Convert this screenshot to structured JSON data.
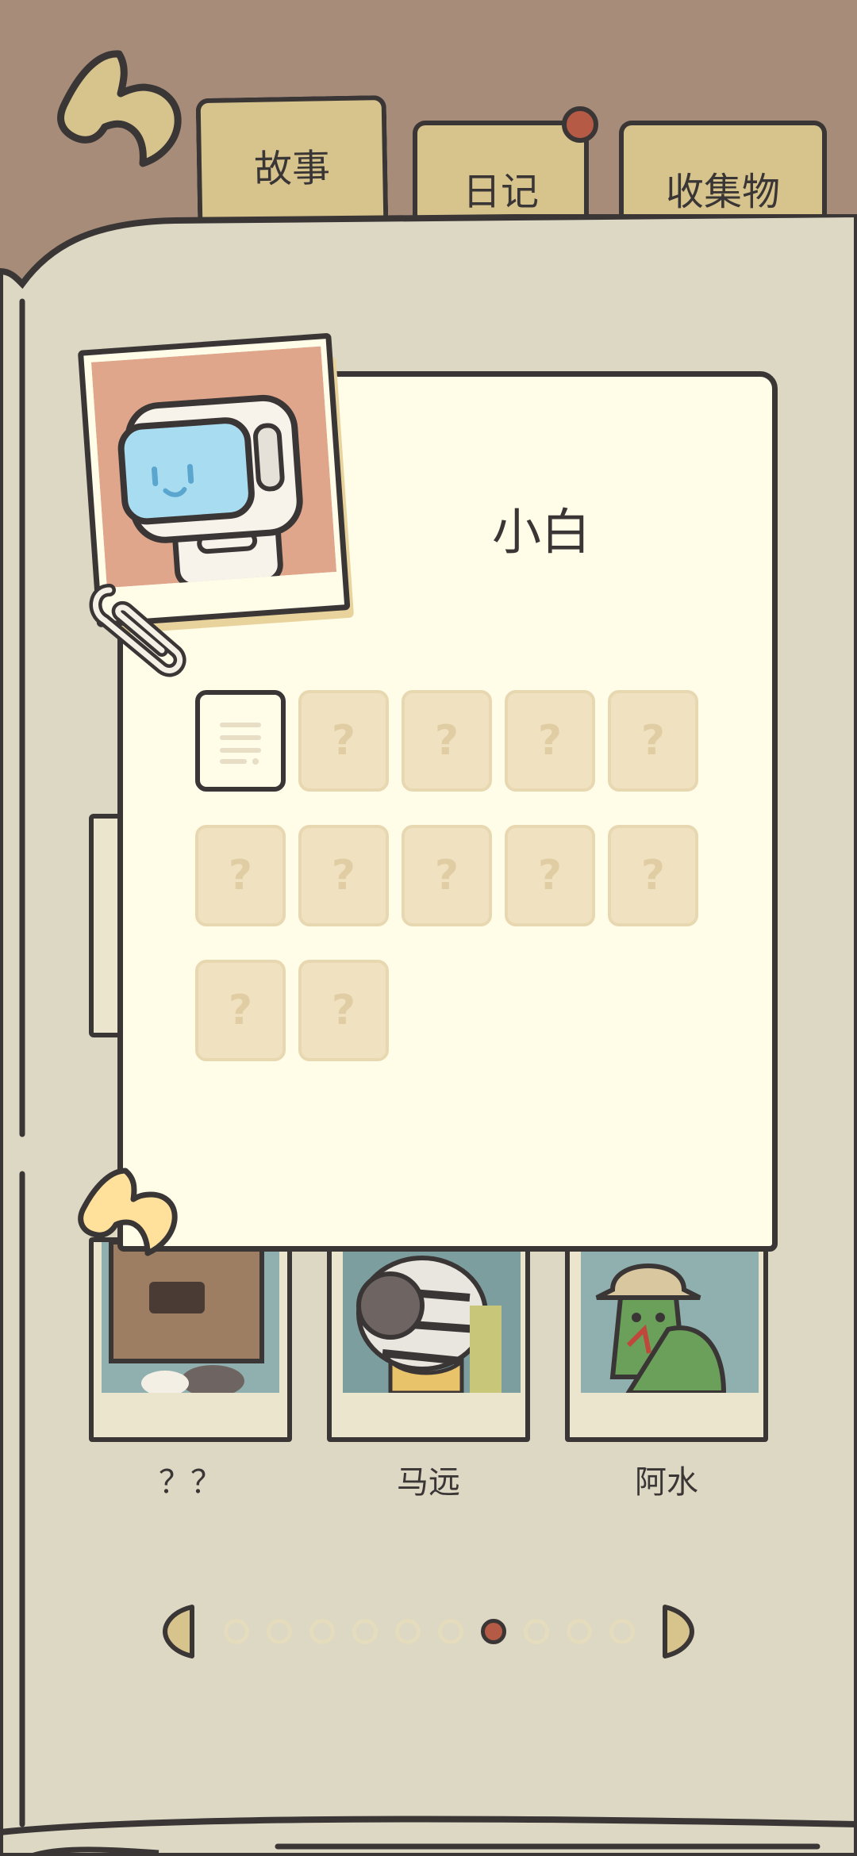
{
  "tabs": [
    {
      "label": "故事"
    },
    {
      "label": "日记"
    },
    {
      "label": "收集物"
    }
  ],
  "card": {
    "character_name": "小白",
    "slots": [
      "unlocked",
      "?",
      "?",
      "?",
      "?",
      "?",
      "?",
      "?",
      "?",
      "?",
      "?",
      "?"
    ]
  },
  "characters": [
    {
      "label": "？？"
    },
    {
      "label": "马远"
    },
    {
      "label": "阿水"
    }
  ],
  "pager": {
    "count": 10,
    "current_page": 7
  },
  "colors": {
    "background_brown": "#a68c79",
    "page_beige": "#ddd8c4",
    "card_cream": "#fffce8",
    "tab_yellow": "#d7c48d",
    "outline": "#3b3636",
    "notification_red": "#b55a45",
    "slot_locked": "#f0e2c0"
  }
}
